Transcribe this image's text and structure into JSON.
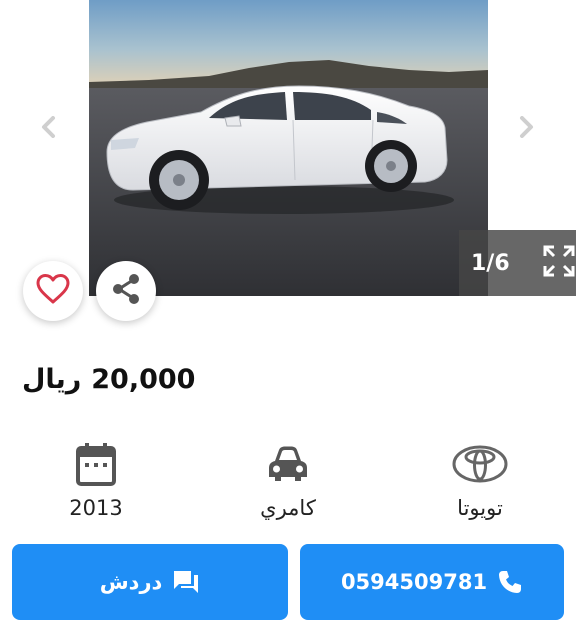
{
  "gallery": {
    "counter": "1/6"
  },
  "listing": {
    "price": "20,000",
    "currency": "ريال"
  },
  "specs": {
    "year": "2013",
    "model": "كامري",
    "make": "تويوتا"
  },
  "actions": {
    "chat_label": "دردش",
    "phone_label": "0594509781"
  },
  "colors": {
    "accent": "#1f8ef5",
    "favorite": "#d9364a",
    "counter_bg": "#464646"
  },
  "icons": {
    "prev": "chevron-left-icon",
    "next": "chevron-right-icon",
    "expand": "fullscreen-icon",
    "favorite": "heart-icon",
    "share": "share-icon",
    "year": "calendar-icon",
    "model": "car-icon",
    "make": "toyota-logo",
    "chat": "chat-icon",
    "phone": "phone-icon"
  }
}
